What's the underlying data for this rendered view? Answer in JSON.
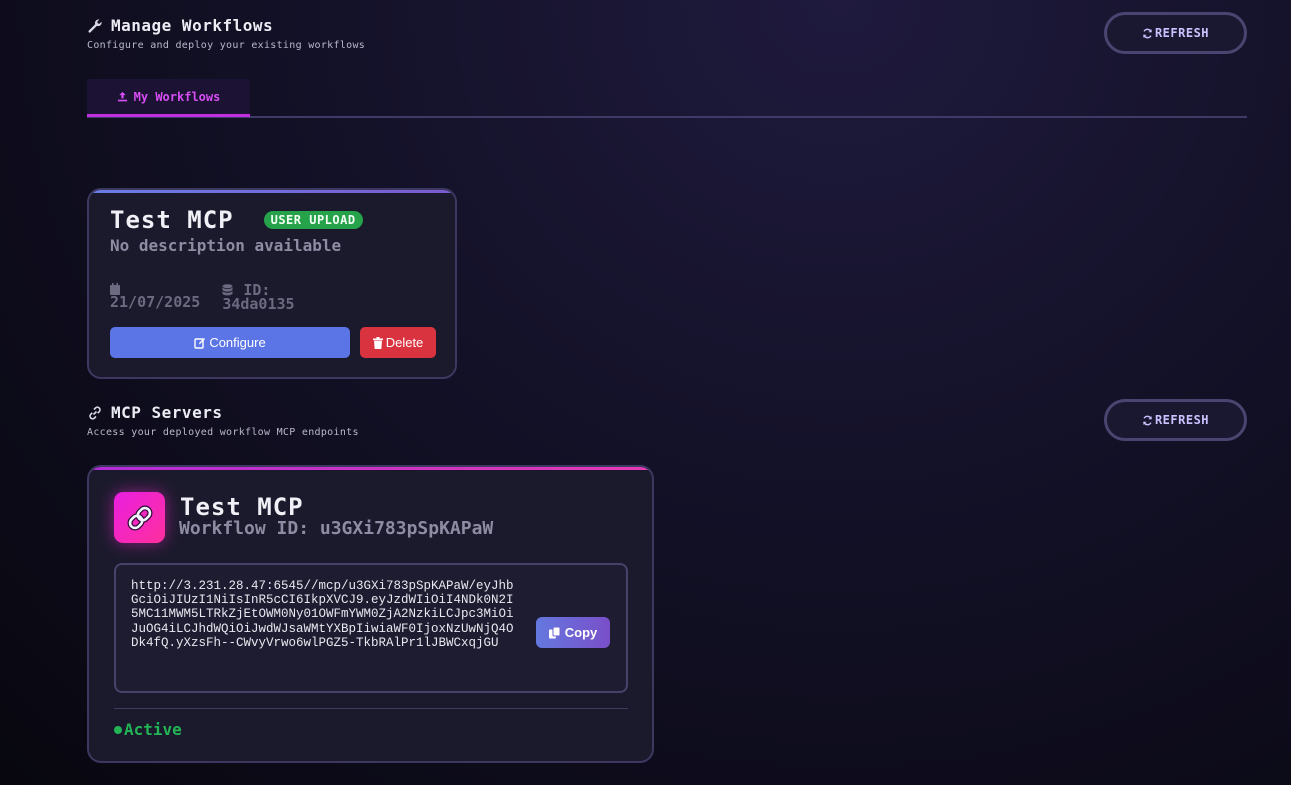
{
  "manage": {
    "title": "Manage Workflows",
    "subtitle": "Configure and deploy your existing workflows",
    "refresh_label": "REFRESH",
    "title_icon": "wrench-icon"
  },
  "tabs": [
    {
      "label": "My Workflows",
      "icon": "upload-icon",
      "active": true
    }
  ],
  "workflow_card": {
    "title": "Test MCP",
    "badge": "USER UPLOAD",
    "description": "No description available",
    "date": "21/07/2025",
    "id_label": "ID:",
    "id_value": "34da0135",
    "configure_label": "Configure",
    "delete_label": "Delete"
  },
  "mcp": {
    "title": "MCP Servers",
    "subtitle": "Access your deployed workflow MCP endpoints",
    "refresh_label": "REFRESH",
    "title_icon": "link-icon"
  },
  "mcp_card": {
    "title": "Test MCP",
    "workflow_id": "Workflow ID: u3GXi783pSpKAPaW",
    "url": "http://3.231.28.47:6545//mcp/u3GXi783pSpKAPaW/eyJhbGciOiJIUzI1NiIsInR5cCI6IkpXVCJ9.eyJzdWIiOiI4NDk0N2I5MC11MWM5LTRkZjEtOWM0Ny01OWFmYWM0ZjA2NzkiLCJpc3MiOiJuOG4iLCJhdWQiOiJwdWJsaWMtYXBpIiwiaWF0IjoxNzUwNjQ4ODk4fQ.yXzsFh--CWvyVrwo6wlPGZ5-TkbRAlPr1lJBWCxqjGU",
    "copy_label": "Copy",
    "status": "Active"
  },
  "colors": {
    "accent_purple": "#c12fe0",
    "badge_green": "#26a34a",
    "configure_blue": "#5b75e6",
    "delete_red": "#d8333f",
    "status_green": "#22b455"
  }
}
